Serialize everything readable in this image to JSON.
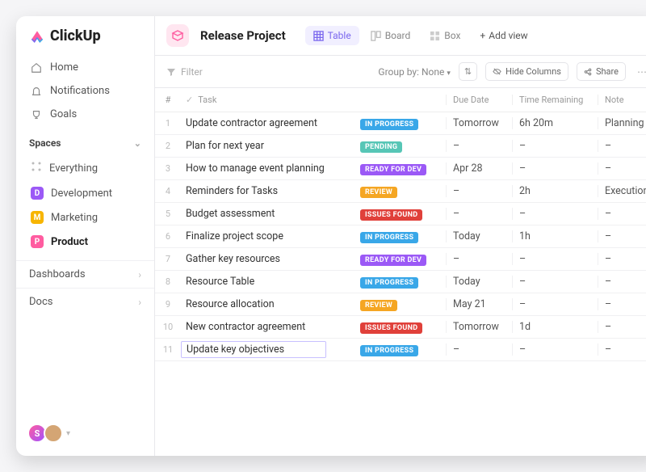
{
  "brand": "ClickUp",
  "nav": {
    "home": "Home",
    "notifications": "Notifications",
    "goals": "Goals"
  },
  "sections": {
    "spaces_label": "Spaces",
    "dashboards": "Dashboards",
    "docs": "Docs"
  },
  "spaces": [
    {
      "label": "Everything",
      "letter": "",
      "color": ""
    },
    {
      "label": "Development",
      "letter": "D",
      "color": "#9b59f6"
    },
    {
      "label": "Marketing",
      "letter": "M",
      "color": "#f7b500"
    },
    {
      "label": "Product",
      "letter": "P",
      "color": "#ff5ca0"
    }
  ],
  "header": {
    "project_title": "Release Project",
    "views": {
      "table": "Table",
      "board": "Board",
      "box": "Box",
      "add": "Add view"
    }
  },
  "toolbar": {
    "filter": "Filter",
    "group_by_label": "Group by:",
    "group_by_value": "None",
    "hide_columns": "Hide Columns",
    "share": "Share"
  },
  "columns": {
    "num": "#",
    "task": "Task",
    "due": "Due Date",
    "time": "Time Remaining",
    "note": "Note"
  },
  "status_colors": {
    "IN PROGRESS": "#39a7e8",
    "PENDING": "#57c6b6",
    "READY FOR DEV": "#9b59f6",
    "REVIEW": "#f5a623",
    "ISSUES FOUND": "#e0403a"
  },
  "rows": [
    {
      "n": "1",
      "task": "Update contractor agreement",
      "status": "IN PROGRESS",
      "due": "Tomorrow",
      "due_red": false,
      "time": "6h 20m",
      "note": "Planning"
    },
    {
      "n": "2",
      "task": "Plan for next year",
      "status": "PENDING",
      "due": "–",
      "due_red": false,
      "time": "–",
      "note": "–"
    },
    {
      "n": "3",
      "task": "How to manage event planning",
      "status": "READY FOR DEV",
      "due": "Apr 28",
      "due_red": true,
      "time": "–",
      "note": "–"
    },
    {
      "n": "4",
      "task": "Reminders for Tasks",
      "status": "REVIEW",
      "due": "–",
      "due_red": false,
      "time": "2h",
      "note": "Execution"
    },
    {
      "n": "5",
      "task": "Budget assessment",
      "status": "ISSUES FOUND",
      "due": "–",
      "due_red": false,
      "time": "–",
      "note": "–"
    },
    {
      "n": "6",
      "task": "Finalize project scope",
      "status": "IN PROGRESS",
      "due": "Today",
      "due_red": true,
      "time": "1h",
      "note": "–"
    },
    {
      "n": "7",
      "task": "Gather key resources",
      "status": "READY FOR DEV",
      "due": "–",
      "due_red": false,
      "time": "–",
      "note": "–"
    },
    {
      "n": "8",
      "task": "Resource Table",
      "status": "IN PROGRESS",
      "due": "Today",
      "due_red": true,
      "time": "–",
      "note": "–"
    },
    {
      "n": "9",
      "task": "Resource allocation",
      "status": "REVIEW",
      "due": "May 21",
      "due_red": false,
      "time": "–",
      "note": "–"
    },
    {
      "n": "10",
      "task": "New contractor agreement",
      "status": "ISSUES FOUND",
      "due": "Tomorrow",
      "due_red": false,
      "time": "1d",
      "note": "–"
    },
    {
      "n": "11",
      "task": "Update key objectives",
      "status": "IN PROGRESS",
      "due": "–",
      "due_red": false,
      "time": "–",
      "note": "–",
      "editing": true
    }
  ],
  "avatar_initial": "S"
}
